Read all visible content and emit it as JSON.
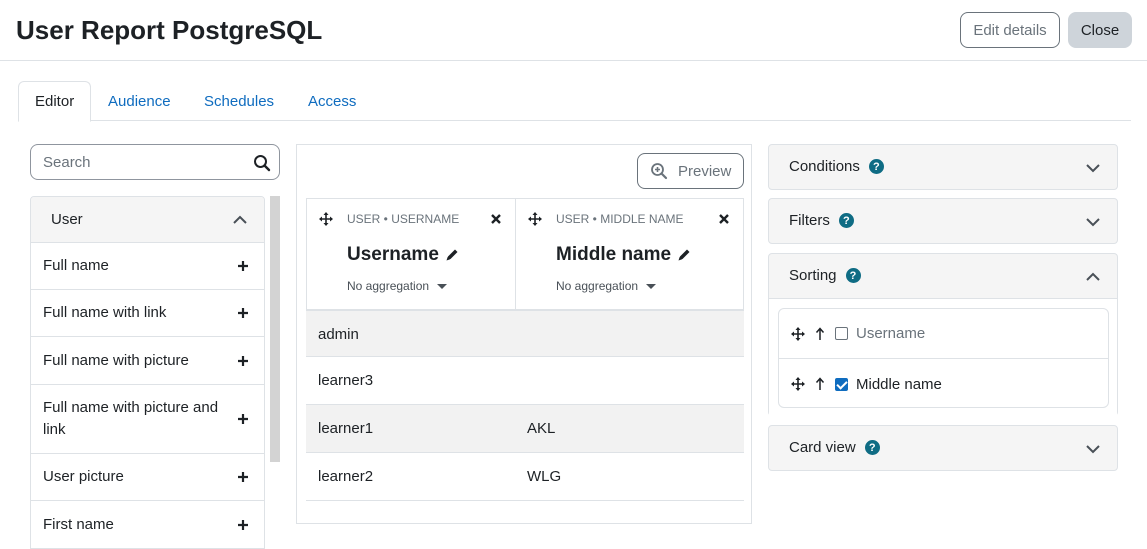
{
  "header": {
    "title": "User Report PostgreSQL",
    "edit_label": "Edit details",
    "close_label": "Close"
  },
  "tabs": [
    {
      "label": "Editor",
      "active": true
    },
    {
      "label": "Audience",
      "active": false
    },
    {
      "label": "Schedules",
      "active": false
    },
    {
      "label": "Access",
      "active": false
    }
  ],
  "sidebar": {
    "search_placeholder": "Search",
    "group_label": "User",
    "items": [
      {
        "label": "Full name"
      },
      {
        "label": "Full name with link"
      },
      {
        "label": "Full name with picture"
      },
      {
        "label": "Full name with picture and link"
      },
      {
        "label": "User picture"
      },
      {
        "label": "First name"
      }
    ]
  },
  "report": {
    "preview_label": "Preview",
    "columns": [
      {
        "category": "USER • USERNAME",
        "name": "Username",
        "aggregation": "No aggregation"
      },
      {
        "category": "USER • MIDDLE NAME",
        "name": "Middle name",
        "aggregation": "No aggregation"
      }
    ],
    "rows": [
      {
        "username": "admin",
        "middle": ""
      },
      {
        "username": "learner3",
        "middle": ""
      },
      {
        "username": "learner1",
        "middle": "AKL"
      },
      {
        "username": "learner2",
        "middle": "WLG"
      }
    ]
  },
  "settings": {
    "conditions_label": "Conditions",
    "filters_label": "Filters",
    "sorting_label": "Sorting",
    "cardview_label": "Card view",
    "sort_items": [
      {
        "label": "Username",
        "checked": false
      },
      {
        "label": "Middle name",
        "checked": true
      }
    ]
  },
  "colors": {
    "link": "#0f6cbf",
    "help": "#0f6c84",
    "border": "#dee2e6"
  }
}
